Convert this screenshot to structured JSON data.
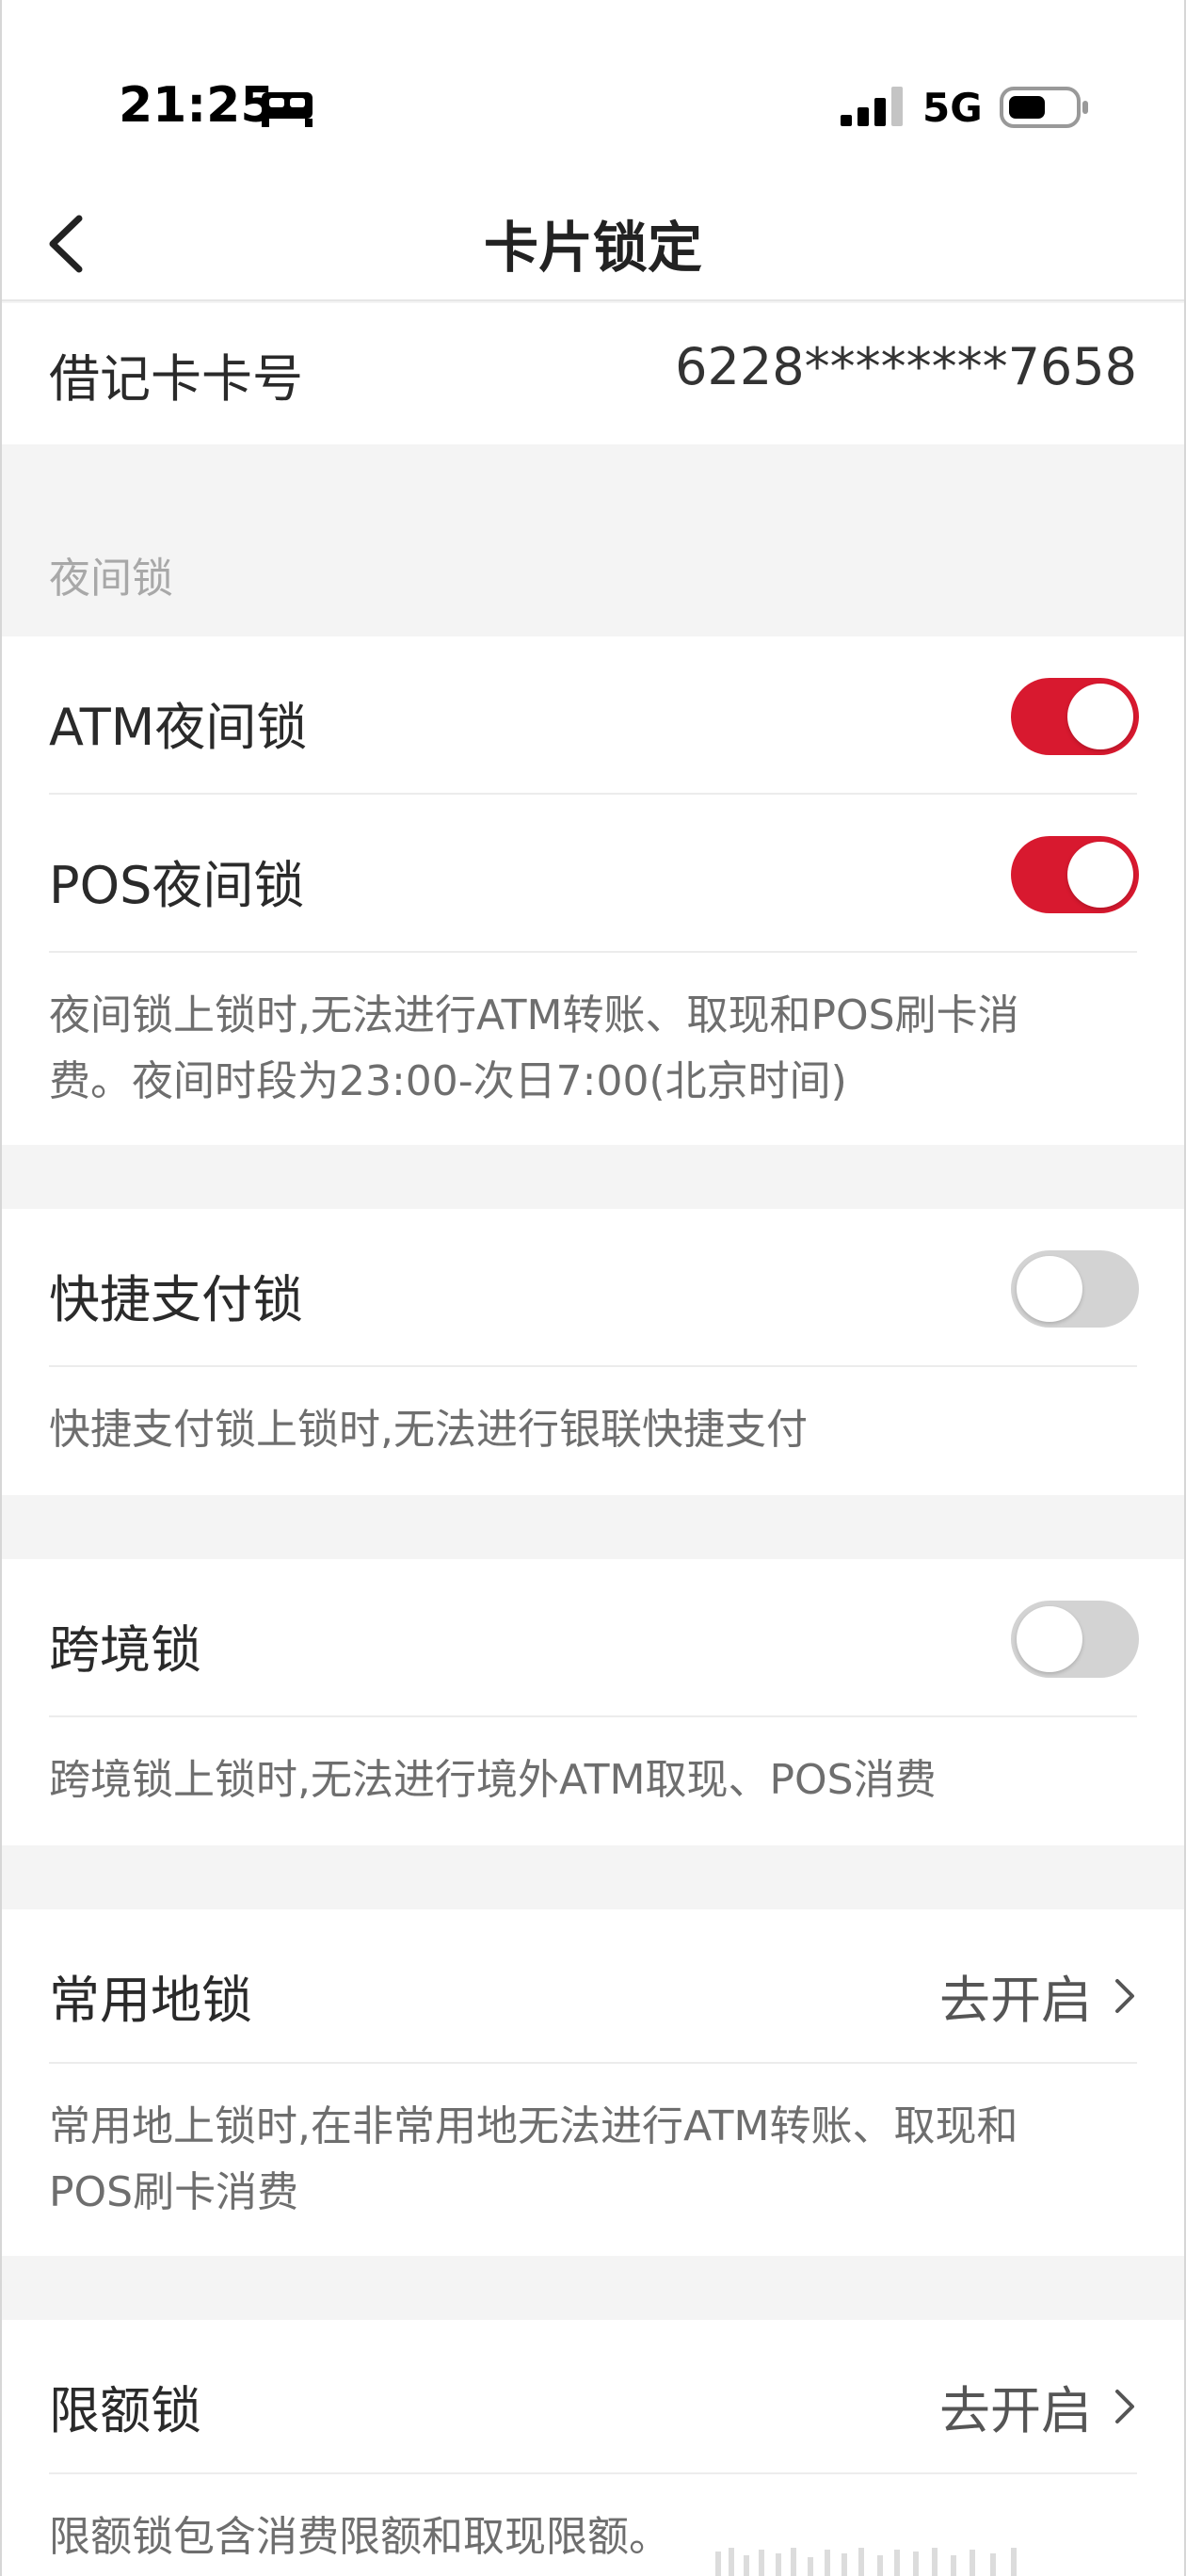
{
  "status_bar": {
    "time": "21:25",
    "network": "5G",
    "icons": [
      "bed-icon",
      "signal-icon",
      "battery-icon"
    ]
  },
  "nav": {
    "title": "卡片锁定",
    "back_icon": "chevron-left-icon"
  },
  "card": {
    "label": "借记卡卡号",
    "number": "6228********7658"
  },
  "night_lock": {
    "section_label": "夜间锁",
    "atm": {
      "label": "ATM夜间锁",
      "enabled": true
    },
    "pos": {
      "label": "POS夜间锁",
      "enabled": true
    },
    "description": "夜间锁上锁时,无法进行ATM转账、取现和POS刷卡消费。夜间时段为23:00-次日7:00(北京时间)"
  },
  "quick_pay_lock": {
    "label": "快捷支付锁",
    "enabled": false,
    "description": "快捷支付锁上锁时,无法进行银联快捷支付"
  },
  "cross_border_lock": {
    "label": "跨境锁",
    "enabled": false,
    "description": "跨境锁上锁时,无法进行境外ATM取现、POS消费"
  },
  "frequent_location_lock": {
    "label": "常用地锁",
    "action": "去开启",
    "description": "常用地上锁时,在非常用地无法进行ATM转账、取现和POS刷卡消费"
  },
  "limit_lock": {
    "label": "限额锁",
    "action": "去开启",
    "description": "限额锁包含消费限额和取现限额。"
  },
  "colors": {
    "accent": "#d8192f",
    "toggle_off": "#d3d3d3",
    "page_bg": "#f4f4f4"
  }
}
